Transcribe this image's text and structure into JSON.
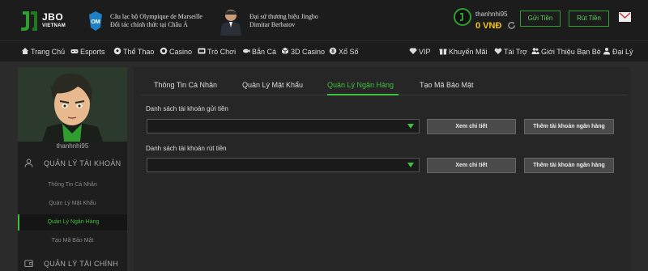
{
  "header": {
    "logo_line1": "JBO",
    "logo_line2": "VIETNAM",
    "promo1_line1": "Câu lạc bộ Olympique de Marseille",
    "promo1_line2": "Đối tác chính thức tại Châu Á",
    "promo2_line1": "Đại sứ thương hiệu Jingbo",
    "promo2_line2": "Dimitar Berbatov",
    "username": "thanhnhi95",
    "balance": "0  VNĐ",
    "deposit_label": "Gửi Tiền",
    "withdraw_label": "Rút Tiền"
  },
  "nav": {
    "items": [
      {
        "label": "Trang Chủ",
        "icon": "home-icon"
      },
      {
        "label": "Esports",
        "icon": "gamepad-icon"
      },
      {
        "label": "Thể Thao",
        "icon": "soccer-ball-icon"
      },
      {
        "label": "Casino",
        "icon": "chip-icon"
      },
      {
        "label": "Trò Chơi",
        "icon": "slot-icon"
      },
      {
        "label": "Bắn Cá",
        "icon": "fish-icon"
      },
      {
        "label": "3D Casino",
        "icon": "cube-icon"
      },
      {
        "label": "Xổ Số",
        "icon": "lottery-icon"
      }
    ],
    "right_items": [
      {
        "label": "VIP",
        "icon": "diamond-icon"
      },
      {
        "label": "Khuyến Mãi",
        "icon": "gift-icon"
      },
      {
        "label": "Tài Trợ",
        "icon": "sponsor-icon"
      },
      {
        "label": "Giới Thiệu Bạn Bè",
        "icon": "users-icon"
      },
      {
        "label": "Đại Lý",
        "icon": "agent-icon"
      }
    ]
  },
  "sidebar": {
    "username": "thanhnhi95",
    "section1": "QUẢN LÝ TÀI KHOẢN",
    "links": [
      {
        "label": "Thông Tin Cá Nhân"
      },
      {
        "label": "Quản Lý Mật Khẩu"
      },
      {
        "label": "Quản Lý Ngân Hàng"
      },
      {
        "label": "Tạo Mã Bảo Mật"
      }
    ],
    "section2": "QUẢN LÝ TÀI CHÍNH"
  },
  "main": {
    "tabs": [
      {
        "label": "Thông Tin Cá Nhân"
      },
      {
        "label": "Quản Lý Mật Khẩu"
      },
      {
        "label": "Quản Lý Ngân Hàng"
      },
      {
        "label": "Tạo Mã Bảo Mật"
      }
    ],
    "active_tab": "Quản Lý Ngân Hàng",
    "deposit_accounts_label": "Danh sách tài khoản gửi tiền",
    "withdraw_accounts_label": "Danh sách tài khoản rút tiền",
    "detail_button": "Xem chi tiết",
    "add_bank_button": "Thêm tài khoản ngân hàng"
  },
  "colors": {
    "accent": "#3fbf3f",
    "balance": "#f5c518",
    "background": "#2b2b2b"
  }
}
